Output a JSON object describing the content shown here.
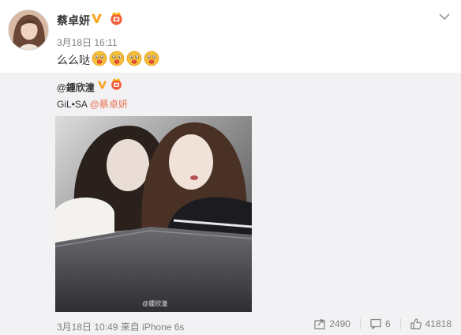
{
  "post": {
    "author": "蔡卓妍",
    "date": "3月18日 16:11",
    "text": "么么哒",
    "emoji_count": 4,
    "emoji_icon": "kiss-emoji-icon"
  },
  "repost": {
    "author": "@鍾欣潼",
    "text_prefix": "GiL•SA ",
    "mention": "@蔡卓妍",
    "photo_watermark": "@鍾欣潼",
    "meta": "3月18日 10:49 来自 iPhone 6s",
    "stats": {
      "forward": "2490",
      "comment": "6",
      "like": "41818"
    }
  },
  "colors": {
    "accent": "#eb7350",
    "verified": "#f6a623",
    "repost_bg": "#f2f2f5"
  }
}
